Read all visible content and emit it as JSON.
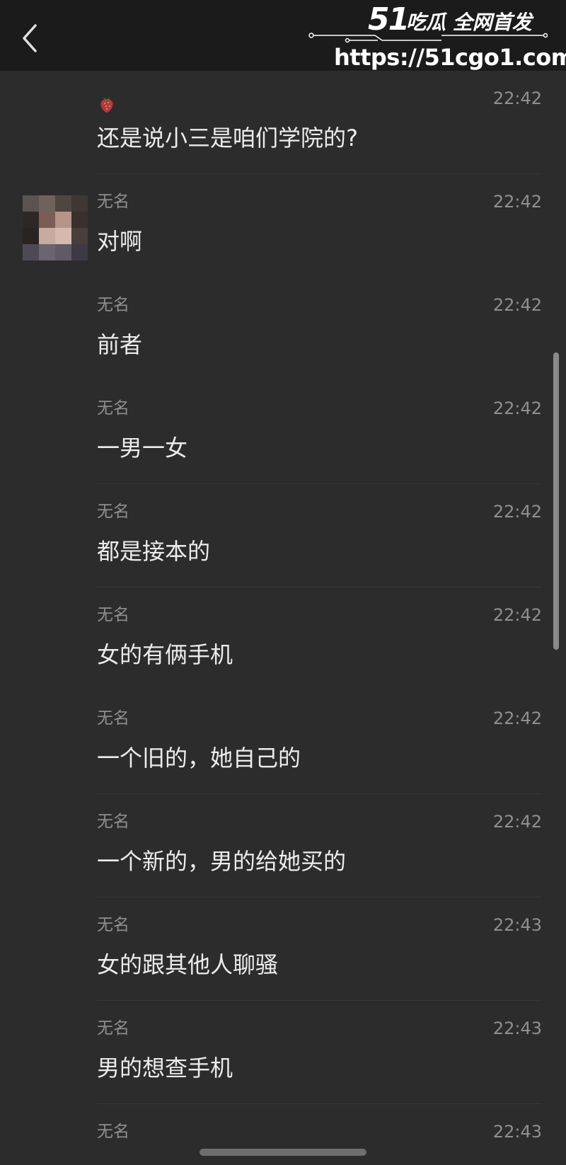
{
  "watermark": {
    "number": "51",
    "tagline": "吃瓜 全网首发",
    "url": "https://51cgo1.com"
  },
  "header": {
    "back_icon": "chevron-left-icon"
  },
  "messages": [
    {
      "name": "",
      "time": "22:42",
      "text": "还是说小三是咱们学院的?",
      "name_icon": "strawberry-icon"
    },
    {
      "name": "无名",
      "time": "22:42",
      "text": "对啊",
      "avatar": "blurred-avatar"
    },
    {
      "name": "无名",
      "time": "22:42",
      "text": "前者"
    },
    {
      "name": "无名",
      "time": "22:42",
      "text": "一男一女"
    },
    {
      "name": "无名",
      "time": "22:42",
      "text": "都是接本的"
    },
    {
      "name": "无名",
      "time": "22:42",
      "text": "女的有俩手机"
    },
    {
      "name": "无名",
      "time": "22:42",
      "text": "一个旧的，她自己的"
    },
    {
      "name": "无名",
      "time": "22:42",
      "text": "一个新的，男的给她买的"
    },
    {
      "name": "无名",
      "time": "22:43",
      "text": "女的跟其他人聊骚"
    },
    {
      "name": "无名",
      "time": "22:43",
      "text": "男的想查手机"
    },
    {
      "name": "无名",
      "time": "22:43",
      "text": ""
    }
  ],
  "colors": {
    "background": "#2c2c2c",
    "topbar": "#1b1b1b",
    "meta_text": "#8f8f8f",
    "message_text": "#ececec"
  }
}
